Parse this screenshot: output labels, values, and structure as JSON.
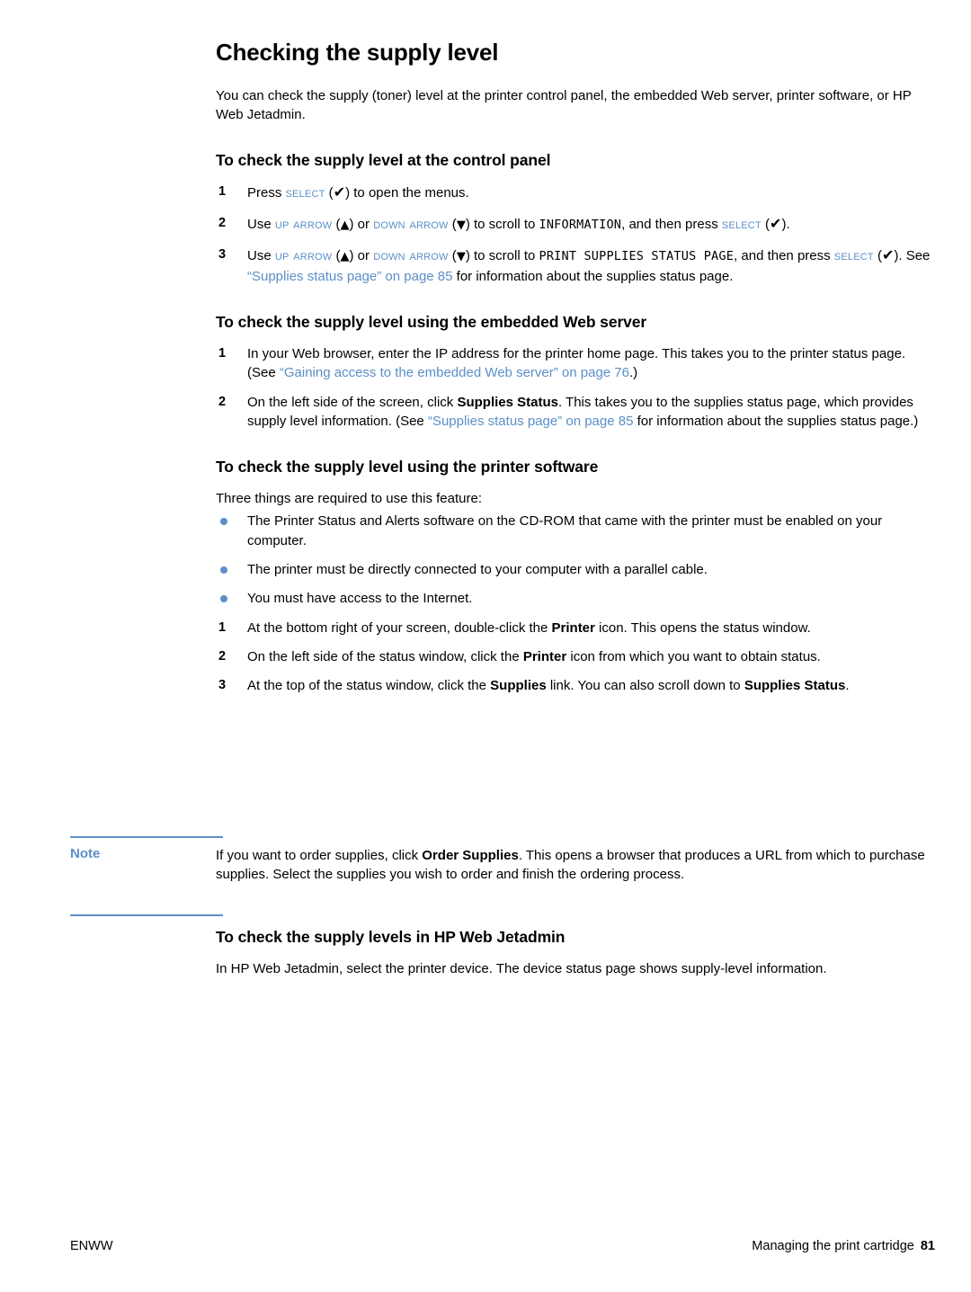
{
  "document": {
    "title": "Checking the supply level",
    "intro": "You can check the supply (toner) level at the printer control panel, the embedded Web server, printer software, or HP Web Jetadmin."
  },
  "colors": {
    "link": "#5b8fc7",
    "accent": "#5b8fc7",
    "text": "#000000"
  },
  "sections": {
    "control_panel": {
      "heading": "To check the supply level at the control panel",
      "steps": [
        {
          "num": "1",
          "pre": "Press ",
          "key1": "Select",
          "glyph1": "check-icon",
          "post": " to open the menus."
        },
        {
          "num": "2",
          "pre": "Use ",
          "key1": "Up arrow",
          "mid1": " or ",
          "key2": "Down arrow",
          "mid2": " to scroll to ",
          "lcd": "INFORMATION",
          "mid3": ", and then press ",
          "key3": "Select",
          "post": "."
        },
        {
          "num": "3",
          "pre": "Use ",
          "key1": "Up arrow",
          "mid1": " or ",
          "key2": "Down arrow",
          "mid2": " to scroll to ",
          "lcd": "PRINT SUPPLIES STATUS PAGE",
          "mid3": ", and then press ",
          "key3": "Select",
          "mid4": ". See ",
          "link": "“Supplies status page” on page 85",
          "post": " for information about the supplies status page."
        }
      ]
    },
    "embedded_web_server": {
      "heading": "To check the supply level using the embedded Web server",
      "steps": [
        {
          "num": "1",
          "pre": "In your Web browser, enter the IP address for the printer home page. This takes you to the printer status page. (See ",
          "link": "“Gaining access to the embedded Web server” on page 76",
          "post": ".)"
        },
        {
          "num": "2",
          "pre": "On the left side of the screen, click ",
          "bold1": "Supplies Status",
          "mid1": ". This takes you to the supplies status page, which provides supply level information. (See ",
          "link": "“Supplies status page” on page 85",
          "post": " for information about the supplies status page.)"
        }
      ]
    },
    "printer_software": {
      "heading": "To check the supply level using the printer software",
      "lead": "Three things are required to use this feature:",
      "bullets": [
        "The Printer Status and Alerts software on the CD-ROM that came with the printer must be enabled on your computer.",
        "The printer must be directly connected to your computer with a parallel cable.",
        "You must have access to the Internet."
      ],
      "steps": [
        {
          "num": "1",
          "pre": "At the bottom right of your screen, double-click the ",
          "bold1": "Printer",
          "post": " icon. This opens the status window."
        },
        {
          "num": "2",
          "pre": "On the left side of the status window, click the ",
          "bold1": "Printer",
          "post": " icon from which you want to obtain status."
        },
        {
          "num": "3",
          "pre": "At the top of the status window, click the ",
          "bold1": "Supplies",
          "mid1": " link. You can also scroll down to ",
          "bold2": "Supplies Status",
          "post": "."
        }
      ]
    },
    "note": {
      "label": "Note",
      "pre": "If you want to order supplies, click ",
      "bold1": "Order Supplies",
      "post": ". This opens a browser that produces a URL from which to purchase supplies. Select the supplies you wish to order and finish the ordering process."
    },
    "web_jetadmin": {
      "heading": "To check the supply levels in HP Web Jetadmin",
      "body": "In HP Web Jetadmin, select the printer device. The device status page shows supply-level information."
    }
  },
  "footer": {
    "left": "ENWW",
    "right": "Managing the print cartridge",
    "page_number": "81"
  },
  "glyphs": {
    "check": "✔",
    "up": "▲",
    "down": "▼"
  }
}
